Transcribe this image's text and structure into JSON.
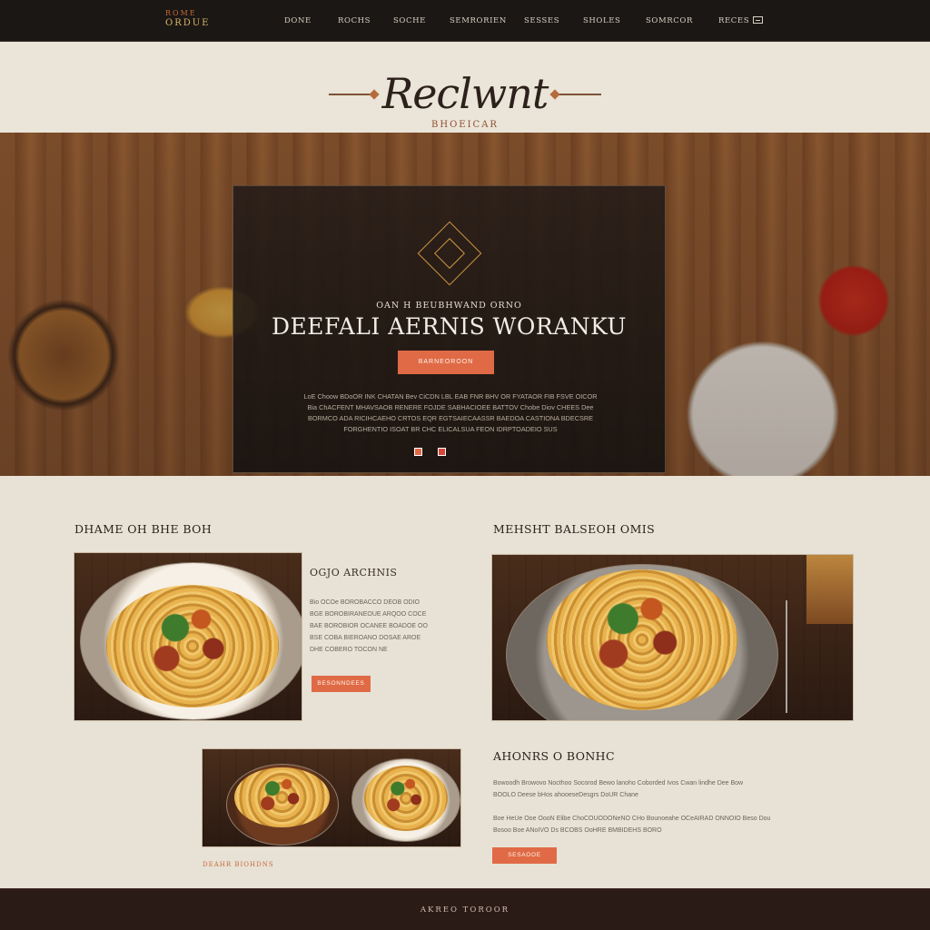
{
  "brand": {
    "logo_top": "ROME",
    "logo_bottom": "ORDUE",
    "title": "Reclwnt",
    "subtitle": "BHOEICAR"
  },
  "nav": {
    "items": [
      {
        "label": "DONE"
      },
      {
        "label": "ROCHS"
      },
      {
        "label": "SOCHE"
      },
      {
        "label": "SEMRORIEN"
      },
      {
        "label": "SESSES"
      },
      {
        "label": "SHOLES"
      },
      {
        "label": "SOMRCOR"
      },
      {
        "label": "RECES"
      }
    ]
  },
  "hero": {
    "kicker": "OAN H BEUBHWAND ORNO",
    "title": "DEEFALI AERNIS WORANKU",
    "button": "BARNEOROON",
    "text_lines": [
      "LoE Choow BDoOR INK CHATAN Bev CiCDN LBL EAB FNR BHV OR FYATAOR FIB FSVE OICOR",
      "Bia ChACFENT MHAVSAOB RENERE FOJDE SABHACIOEE BATTOV Chobe Diov CHEES Dee",
      "BORMCO ADA RICIHCAEHO CRTOS EQR EGTSAIECAASSR BAEDOA CASTIONA BDECSRE",
      "FORGHENTIO ISOAT BR CHC ELICALSUA FEON IDRPTOADEIO SUS"
    ]
  },
  "section_left": {
    "heading": "DHAME OH BHE BOH",
    "subtitle": "OGJO ARCHNIS",
    "text_lines": [
      "Bio OCOe BOROBACCO DEOB ODIO",
      "BGE BOROBIRANEOUE ARQOO COCE",
      "BAE BOROBIOR OCANEE BOADOE OO",
      "BSE COBA BIEROANO DOSAE AROE",
      "DHE COBERO TOCON NE"
    ],
    "button": "BESONNDEES"
  },
  "section_right": {
    "heading": "MEHSHT BALSEOH OMIS"
  },
  "section_bottom": {
    "heading": "AHONRS O BONHC",
    "text_lines": [
      "Bowoodh Browovo Nocthoo Socorod Bewo lanoho Coborded Ivos Cwan lindhe Dee Bow",
      "BOOLO Deese bHos ahooeseDesgrs DoUR Chane"
    ],
    "text_lines_2": [
      "Boe HeUe Ooe OooN Elibe ChoCOUODONeNO CHo Bounoeahe OCeAIRAD ONNOIO Beso Dou",
      "Bosoo Boe ANoIVO Ds BCOBS OoHRE BMBIDEHS BORO"
    ],
    "button": "SESAOOE",
    "caption": "DEAHR BIOHDNS"
  },
  "footer": {
    "text": "AKREO TOROOR"
  },
  "colors": {
    "accent": "#e06a46",
    "dark": "#1b1714",
    "paper": "#e9e1d3",
    "footer": "#2b1b17"
  },
  "icons": [
    "cart-icon",
    "emblem-icon",
    "slider-dot-icon"
  ]
}
